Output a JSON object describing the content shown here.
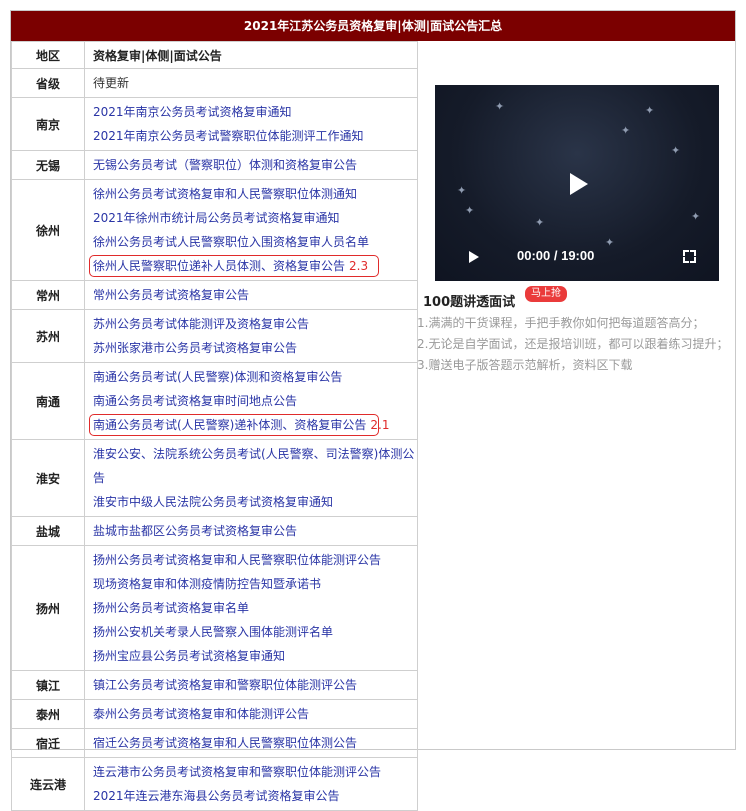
{
  "header": {
    "title": "2021年江苏公务员资格复审|体测|面试公告汇总"
  },
  "table": {
    "col_region": "地区",
    "col_notice": "资格复审|体侧|面试公告",
    "rows": [
      {
        "region": "省级",
        "links": [
          {
            "text": "待更新",
            "plain": true
          }
        ]
      },
      {
        "region": "南京",
        "links": [
          {
            "text": "2021年南京公务员考试资格复审通知"
          },
          {
            "text": "2021年南京公务员考试警察职位体能测评工作通知"
          }
        ]
      },
      {
        "region": "无锡",
        "links": [
          {
            "text": "无锡公务员考试（警察职位）体测和资格复审公告"
          }
        ]
      },
      {
        "region": "徐州",
        "links": [
          {
            "text": "徐州公务员考试资格复审和人民警察职位体测通知"
          },
          {
            "text": "2021年徐州市统计局公务员考试资格复审通知"
          },
          {
            "text": "徐州公务员考试人民警察职位入围资格复审人员名单"
          },
          {
            "text": "徐州人民警察职位递补人员体测、资格复审公告",
            "date": "2.3",
            "boxed": true
          }
        ]
      },
      {
        "region": "常州",
        "links": [
          {
            "text": "常州公务员考试资格复审公告"
          }
        ]
      },
      {
        "region": "苏州",
        "links": [
          {
            "text": "苏州公务员考试体能测评及资格复审公告"
          },
          {
            "text": "苏州张家港市公务员考试资格复审公告"
          }
        ]
      },
      {
        "region": "南通",
        "links": [
          {
            "text": "南通公务员考试(人民警察)体测和资格复审公告"
          },
          {
            "text": "南通公务员考试资格复审时间地点公告"
          },
          {
            "text": "南通公务员考试(人民警察)递补体测、资格复审公告",
            "date": "2.1",
            "boxed": true
          }
        ]
      },
      {
        "region": "淮安",
        "links": [
          {
            "text": "淮安公安、法院系统公务员考试(人民警察、司法警察)体测公告",
            "wrap": true
          },
          {
            "text": "淮安市中级人民法院公务员考试资格复审通知"
          }
        ]
      },
      {
        "region": "盐城",
        "links": [
          {
            "text": "盐城市盐都区公务员考试资格复审公告"
          }
        ]
      },
      {
        "region": "扬州",
        "links": [
          {
            "text": "扬州公务员考试资格复审和人民警察职位体能测评公告"
          },
          {
            "text": "现场资格复审和体测疫情防控告知暨承诺书"
          },
          {
            "text": "扬州公务员考试资格复审名单"
          },
          {
            "text": "扬州公安机关考录人民警察入围体能测评名单"
          },
          {
            "text": "扬州宝应县公务员考试资格复审通知"
          }
        ]
      },
      {
        "region": "镇江",
        "links": [
          {
            "text": "镇江公务员考试资格复审和警察职位体能测评公告"
          }
        ]
      },
      {
        "region": "泰州",
        "links": [
          {
            "text": "泰州公务员考试资格复审和体能测评公告"
          }
        ]
      },
      {
        "region": "宿迁",
        "links": [
          {
            "text": "宿迁公务员考试资格复审和人民警察职位体测公告"
          }
        ]
      },
      {
        "region": "连云港",
        "links": [
          {
            "text": "连云港市公务员考试资格复审和警察职位体能测评公告"
          },
          {
            "text": "2021年连云港东海县公务员考试资格复审公告"
          }
        ]
      }
    ]
  },
  "video": {
    "time": "00:00 / 19:00",
    "icons": [
      "play-icon",
      "fullscreen-icon"
    ]
  },
  "course": {
    "title": "100题讲透面试",
    "badge": "马上抢",
    "bullets": [
      "1.满满的干货课程，手把手教你如何把每道题答高分；",
      "2.无论是自学面试，还是报培训班，都可以跟着练习提升；",
      "3.赠送电子版答题示范解析，资料区下载"
    ]
  },
  "colors": {
    "header_bg": "#7b0000",
    "link": "#2a35a6",
    "highlight": "#e02b2b",
    "badge": "#ea3b3b"
  }
}
